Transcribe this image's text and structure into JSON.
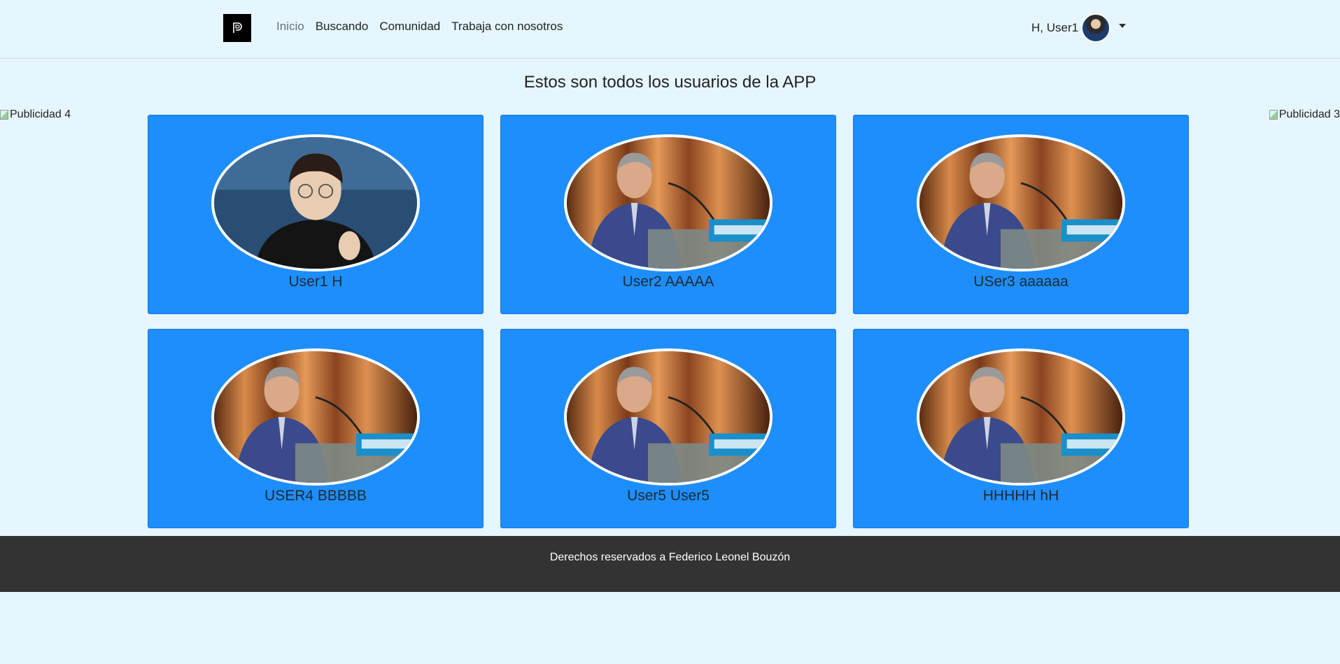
{
  "nav": {
    "logo_letter": "P",
    "links": [
      "Inicio",
      "Buscando",
      "Comunidad",
      "Trabaja con nosotros"
    ],
    "user_greeting": "H, User1"
  },
  "page_title": "Estos son todos los usuarios de la APP",
  "ads": {
    "left": "Publicidad 4",
    "right": "Publicidad 3"
  },
  "users": [
    {
      "name": "User1 H",
      "photo": "young-man-glasses-photo"
    },
    {
      "name": "User2 AAAAA",
      "photo": "speaker-podium-photo"
    },
    {
      "name": "USer3 aaaaaa",
      "photo": "speaker-podium-photo"
    },
    {
      "name": "USER4 BBBBB",
      "photo": "speaker-podium-photo"
    },
    {
      "name": "User5 User5",
      "photo": "speaker-podium-photo"
    },
    {
      "name": "HHHHH hH",
      "photo": "speaker-podium-photo"
    }
  ],
  "footer": {
    "text": "Derechos reservados a Federico Leonel Bouzón"
  },
  "colors": {
    "background": "#e6f6fe",
    "card": "#1e8efc",
    "footer": "#333333"
  }
}
